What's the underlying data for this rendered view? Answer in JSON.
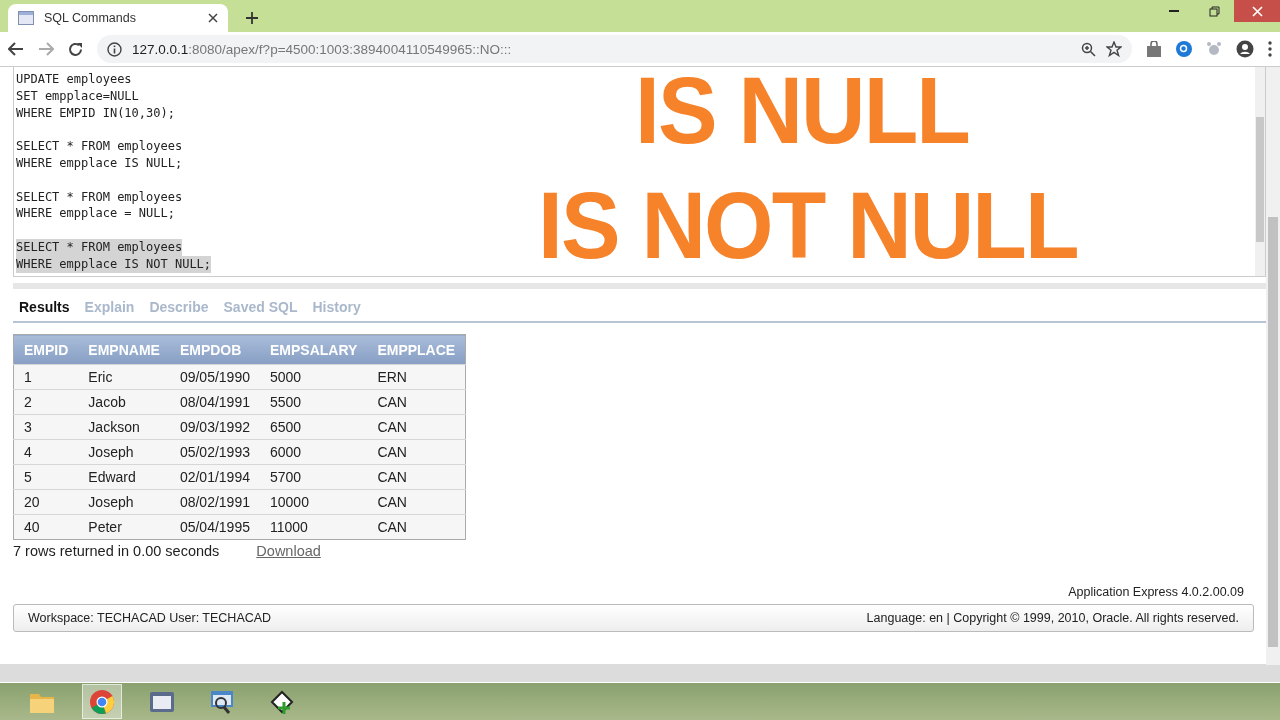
{
  "browser": {
    "tab_title": "SQL Commands",
    "url_host": "127.0.0.1",
    "url_rest": ":8080/apex/f?p=4500:1003:3894004110549965::NO:::"
  },
  "editor": {
    "statements": [
      {
        "selected": false,
        "lines": [
          "UPDATE employees",
          "SET empplace=NULL",
          "WHERE EMPID IN(10,30);"
        ]
      },
      {
        "selected": false,
        "lines": [
          "SELECT * FROM employees",
          "WHERE empplace IS NULL;"
        ]
      },
      {
        "selected": false,
        "lines": [
          "SELECT * FROM employees",
          "WHERE empplace = NULL;"
        ]
      },
      {
        "selected": true,
        "lines": [
          "SELECT * FROM employees",
          "WHERE empplace IS NOT NULL;"
        ]
      }
    ]
  },
  "overlay_titles": [
    "IS NULL",
    "IS NOT NULL"
  ],
  "tabs": [
    {
      "label": "Results",
      "selected": true
    },
    {
      "label": "Explain",
      "selected": false
    },
    {
      "label": "Describe",
      "selected": false
    },
    {
      "label": "Saved SQL",
      "selected": false
    },
    {
      "label": "History",
      "selected": false
    }
  ],
  "table": {
    "columns": [
      "EMPID",
      "EMPNAME",
      "EMPDOB",
      "EMPSALARY",
      "EMPPLACE"
    ],
    "rows": [
      [
        "1",
        "Eric",
        "09/05/1990",
        "5000",
        "ERN"
      ],
      [
        "2",
        "Jacob",
        "08/04/1991",
        "5500",
        "CAN"
      ],
      [
        "3",
        "Jackson",
        "09/03/1992",
        "6500",
        "CAN"
      ],
      [
        "4",
        "Joseph",
        "05/02/1993",
        "6000",
        "CAN"
      ],
      [
        "5",
        "Edward",
        "02/01/1994",
        "5700",
        "CAN"
      ],
      [
        "20",
        "Joseph",
        "08/02/1991",
        "10000",
        "CAN"
      ],
      [
        "40",
        "Peter",
        "05/04/1995",
        "11000",
        "CAN"
      ]
    ]
  },
  "result_summary": "7 rows returned in 0.00 seconds",
  "download_link": "Download",
  "version": "Application Express 4.0.2.00.09",
  "footer": {
    "workspace": "Workspace: TECHACAD User: TECHACAD",
    "copyright": "Language: en | Copyright © 1999, 2010, Oracle. All rights reserved."
  },
  "taskbar": [
    {
      "kind": "folder",
      "selected": false
    },
    {
      "kind": "chrome",
      "selected": true
    },
    {
      "kind": "window",
      "selected": false
    },
    {
      "kind": "search",
      "selected": false
    },
    {
      "kind": "tool",
      "selected": false
    }
  ]
}
